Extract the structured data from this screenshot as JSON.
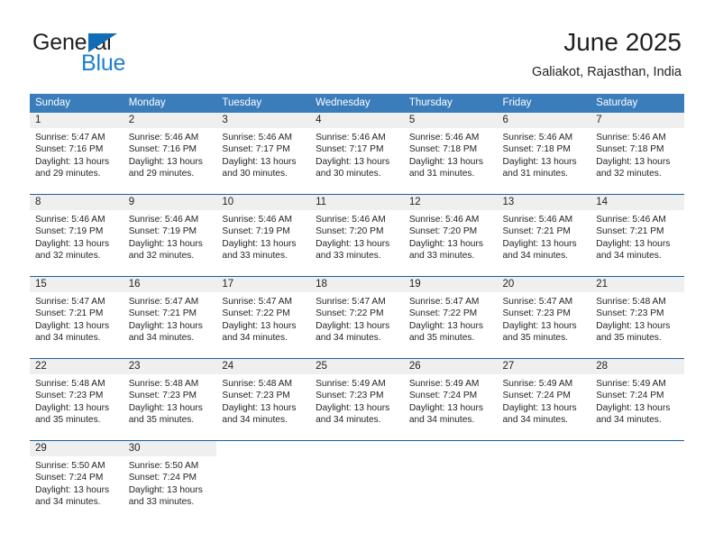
{
  "logo": {
    "text_primary": "General",
    "text_secondary": "Blue",
    "primary_color": "#231f20",
    "secondary_color": "#1c7fd1",
    "triangle_color": "#0f6cb5"
  },
  "header": {
    "title": "June 2025",
    "subtitle": "Galiakot, Rajasthan, India"
  },
  "theme": {
    "header_row_bg": "#3a7dba",
    "row_divider": "#195f9e",
    "day_band_bg": "#efefef",
    "text_color": "#231f20"
  },
  "weekdays": [
    "Sunday",
    "Monday",
    "Tuesday",
    "Wednesday",
    "Thursday",
    "Friday",
    "Saturday"
  ],
  "weeks": [
    [
      {
        "day": "1",
        "sunrise": "Sunrise: 5:47 AM",
        "sunset": "Sunset: 7:16 PM",
        "daylight1": "Daylight: 13 hours",
        "daylight2": "and 29 minutes."
      },
      {
        "day": "2",
        "sunrise": "Sunrise: 5:46 AM",
        "sunset": "Sunset: 7:16 PM",
        "daylight1": "Daylight: 13 hours",
        "daylight2": "and 29 minutes."
      },
      {
        "day": "3",
        "sunrise": "Sunrise: 5:46 AM",
        "sunset": "Sunset: 7:17 PM",
        "daylight1": "Daylight: 13 hours",
        "daylight2": "and 30 minutes."
      },
      {
        "day": "4",
        "sunrise": "Sunrise: 5:46 AM",
        "sunset": "Sunset: 7:17 PM",
        "daylight1": "Daylight: 13 hours",
        "daylight2": "and 30 minutes."
      },
      {
        "day": "5",
        "sunrise": "Sunrise: 5:46 AM",
        "sunset": "Sunset: 7:18 PM",
        "daylight1": "Daylight: 13 hours",
        "daylight2": "and 31 minutes."
      },
      {
        "day": "6",
        "sunrise": "Sunrise: 5:46 AM",
        "sunset": "Sunset: 7:18 PM",
        "daylight1": "Daylight: 13 hours",
        "daylight2": "and 31 minutes."
      },
      {
        "day": "7",
        "sunrise": "Sunrise: 5:46 AM",
        "sunset": "Sunset: 7:18 PM",
        "daylight1": "Daylight: 13 hours",
        "daylight2": "and 32 minutes."
      }
    ],
    [
      {
        "day": "8",
        "sunrise": "Sunrise: 5:46 AM",
        "sunset": "Sunset: 7:19 PM",
        "daylight1": "Daylight: 13 hours",
        "daylight2": "and 32 minutes."
      },
      {
        "day": "9",
        "sunrise": "Sunrise: 5:46 AM",
        "sunset": "Sunset: 7:19 PM",
        "daylight1": "Daylight: 13 hours",
        "daylight2": "and 32 minutes."
      },
      {
        "day": "10",
        "sunrise": "Sunrise: 5:46 AM",
        "sunset": "Sunset: 7:19 PM",
        "daylight1": "Daylight: 13 hours",
        "daylight2": "and 33 minutes."
      },
      {
        "day": "11",
        "sunrise": "Sunrise: 5:46 AM",
        "sunset": "Sunset: 7:20 PM",
        "daylight1": "Daylight: 13 hours",
        "daylight2": "and 33 minutes."
      },
      {
        "day": "12",
        "sunrise": "Sunrise: 5:46 AM",
        "sunset": "Sunset: 7:20 PM",
        "daylight1": "Daylight: 13 hours",
        "daylight2": "and 33 minutes."
      },
      {
        "day": "13",
        "sunrise": "Sunrise: 5:46 AM",
        "sunset": "Sunset: 7:21 PM",
        "daylight1": "Daylight: 13 hours",
        "daylight2": "and 34 minutes."
      },
      {
        "day": "14",
        "sunrise": "Sunrise: 5:46 AM",
        "sunset": "Sunset: 7:21 PM",
        "daylight1": "Daylight: 13 hours",
        "daylight2": "and 34 minutes."
      }
    ],
    [
      {
        "day": "15",
        "sunrise": "Sunrise: 5:47 AM",
        "sunset": "Sunset: 7:21 PM",
        "daylight1": "Daylight: 13 hours",
        "daylight2": "and 34 minutes."
      },
      {
        "day": "16",
        "sunrise": "Sunrise: 5:47 AM",
        "sunset": "Sunset: 7:21 PM",
        "daylight1": "Daylight: 13 hours",
        "daylight2": "and 34 minutes."
      },
      {
        "day": "17",
        "sunrise": "Sunrise: 5:47 AM",
        "sunset": "Sunset: 7:22 PM",
        "daylight1": "Daylight: 13 hours",
        "daylight2": "and 34 minutes."
      },
      {
        "day": "18",
        "sunrise": "Sunrise: 5:47 AM",
        "sunset": "Sunset: 7:22 PM",
        "daylight1": "Daylight: 13 hours",
        "daylight2": "and 34 minutes."
      },
      {
        "day": "19",
        "sunrise": "Sunrise: 5:47 AM",
        "sunset": "Sunset: 7:22 PM",
        "daylight1": "Daylight: 13 hours",
        "daylight2": "and 35 minutes."
      },
      {
        "day": "20",
        "sunrise": "Sunrise: 5:47 AM",
        "sunset": "Sunset: 7:23 PM",
        "daylight1": "Daylight: 13 hours",
        "daylight2": "and 35 minutes."
      },
      {
        "day": "21",
        "sunrise": "Sunrise: 5:48 AM",
        "sunset": "Sunset: 7:23 PM",
        "daylight1": "Daylight: 13 hours",
        "daylight2": "and 35 minutes."
      }
    ],
    [
      {
        "day": "22",
        "sunrise": "Sunrise: 5:48 AM",
        "sunset": "Sunset: 7:23 PM",
        "daylight1": "Daylight: 13 hours",
        "daylight2": "and 35 minutes."
      },
      {
        "day": "23",
        "sunrise": "Sunrise: 5:48 AM",
        "sunset": "Sunset: 7:23 PM",
        "daylight1": "Daylight: 13 hours",
        "daylight2": "and 35 minutes."
      },
      {
        "day": "24",
        "sunrise": "Sunrise: 5:48 AM",
        "sunset": "Sunset: 7:23 PM",
        "daylight1": "Daylight: 13 hours",
        "daylight2": "and 34 minutes."
      },
      {
        "day": "25",
        "sunrise": "Sunrise: 5:49 AM",
        "sunset": "Sunset: 7:23 PM",
        "daylight1": "Daylight: 13 hours",
        "daylight2": "and 34 minutes."
      },
      {
        "day": "26",
        "sunrise": "Sunrise: 5:49 AM",
        "sunset": "Sunset: 7:24 PM",
        "daylight1": "Daylight: 13 hours",
        "daylight2": "and 34 minutes."
      },
      {
        "day": "27",
        "sunrise": "Sunrise: 5:49 AM",
        "sunset": "Sunset: 7:24 PM",
        "daylight1": "Daylight: 13 hours",
        "daylight2": "and 34 minutes."
      },
      {
        "day": "28",
        "sunrise": "Sunrise: 5:49 AM",
        "sunset": "Sunset: 7:24 PM",
        "daylight1": "Daylight: 13 hours",
        "daylight2": "and 34 minutes."
      }
    ],
    [
      {
        "day": "29",
        "sunrise": "Sunrise: 5:50 AM",
        "sunset": "Sunset: 7:24 PM",
        "daylight1": "Daylight: 13 hours",
        "daylight2": "and 34 minutes."
      },
      {
        "day": "30",
        "sunrise": "Sunrise: 5:50 AM",
        "sunset": "Sunset: 7:24 PM",
        "daylight1": "Daylight: 13 hours",
        "daylight2": "and 33 minutes."
      },
      {
        "day": "",
        "sunrise": "",
        "sunset": "",
        "daylight1": "",
        "daylight2": ""
      },
      {
        "day": "",
        "sunrise": "",
        "sunset": "",
        "daylight1": "",
        "daylight2": ""
      },
      {
        "day": "",
        "sunrise": "",
        "sunset": "",
        "daylight1": "",
        "daylight2": ""
      },
      {
        "day": "",
        "sunrise": "",
        "sunset": "",
        "daylight1": "",
        "daylight2": ""
      },
      {
        "day": "",
        "sunrise": "",
        "sunset": "",
        "daylight1": "",
        "daylight2": ""
      }
    ]
  ]
}
